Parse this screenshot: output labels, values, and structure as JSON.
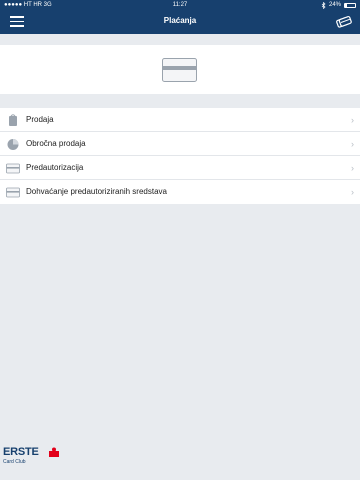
{
  "statusbar": {
    "carrier": "●●●●● HT HR  3G",
    "time": "11:27",
    "battery": "24%",
    "battery_level": 0.24
  },
  "navbar": {
    "title": "Plaćanja",
    "menu_icon": "hamburger-icon",
    "right_icon": "cards-icon"
  },
  "card_panel": {
    "icon": "card-icon"
  },
  "menu": {
    "items": [
      {
        "label": "Prodaja",
        "icon": "bag-icon"
      },
      {
        "label": "Obročna prodaja",
        "icon": "pie-icon"
      },
      {
        "label": "Predautorizacija",
        "icon": "card-icon"
      },
      {
        "label": "Dohvaćanje predautoriziranih sredstava",
        "icon": "card-icon"
      }
    ],
    "chevron": "›"
  },
  "logo": {
    "brand": "ERSTE",
    "sub": "Card Club"
  },
  "colors": {
    "header": "#17406e",
    "background": "#e8ebef",
    "accent_red": "#e2001a"
  }
}
